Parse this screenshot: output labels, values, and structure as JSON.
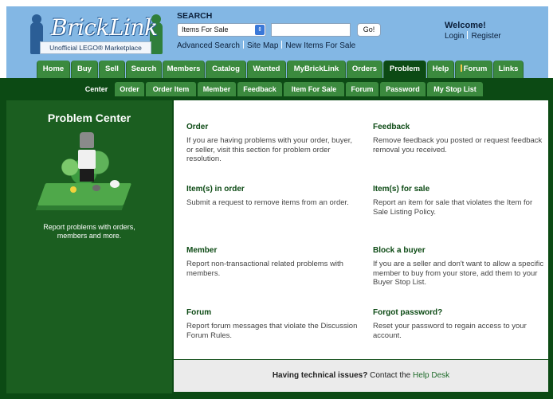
{
  "logo": {
    "brand": "BrickLink",
    "tagline": "Unofficial LEGO® Marketplace"
  },
  "search": {
    "title": "SEARCH",
    "select_value": "Items For Sale",
    "input_value": "",
    "go_label": "Go!",
    "links": [
      "Advanced Search",
      "Site Map",
      "New Items For Sale"
    ]
  },
  "welcome": {
    "title": "Welcome!",
    "login": "Login",
    "register": "Register"
  },
  "nav": {
    "tabs": [
      "Home",
      "Buy",
      "Sell",
      "Search",
      "Members",
      "Catalog",
      "Wanted",
      "MyBrickLink",
      "Orders",
      "Problem",
      "Help",
      "Forum",
      "Links"
    ],
    "active": "Problem"
  },
  "subnav": {
    "tabs": [
      "Center",
      "Order",
      "Order Item",
      "Member",
      "Feedback",
      "Item For Sale",
      "Forum",
      "Password",
      "My Stop List"
    ],
    "active": "Center"
  },
  "sidebar": {
    "title": "Problem Center",
    "caption": "Report problems with orders, members and more."
  },
  "sections": [
    {
      "title": "Order",
      "desc": "If you are having problems with your order, buyer, or seller, visit this section for problem order resolution."
    },
    {
      "title": "Feedback",
      "desc": "Remove feedback you posted or request feedback removal you received."
    },
    {
      "title": "Item(s) in order",
      "desc": "Submit a request to remove items from an order."
    },
    {
      "title": "Item(s) for sale",
      "desc": "Report an item for sale that violates the Item for Sale Listing Policy."
    },
    {
      "title": "Member",
      "desc": "Report non-transactional related problems with members."
    },
    {
      "title": "Block a buyer",
      "desc": "If you are a seller and don't want to allow a specific member to buy from your store, add them to your Buyer Stop List."
    },
    {
      "title": "Forum",
      "desc": "Report forum messages that violate the Discussion Forum Rules."
    },
    {
      "title": "Forgot password?",
      "desc": "Reset your password to regain access to your account."
    }
  ],
  "footer": {
    "bold": "Having technical issues?",
    "text": "Contact the",
    "link": "Help Desk"
  },
  "colors": {
    "header_bg": "#83b7e4",
    "nav_tab": "#3b8a3e",
    "nav_active": "#0c4a14",
    "sidebar_bg": "#1b5e20"
  }
}
